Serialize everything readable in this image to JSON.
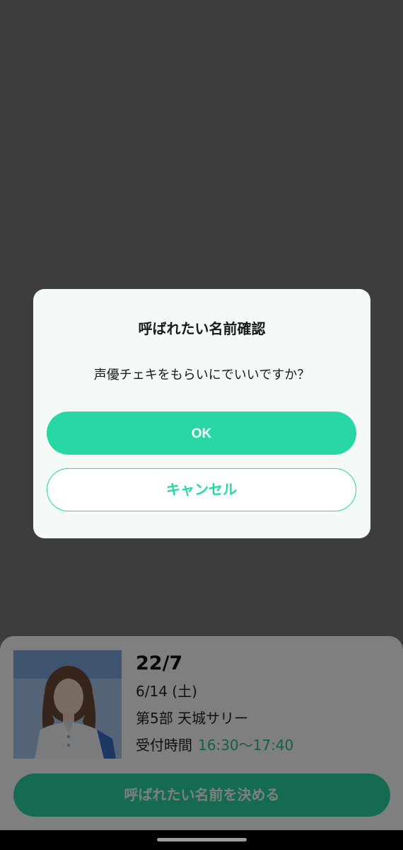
{
  "dialog": {
    "title": "呼ばれたい名前確認",
    "message": "声優チェキをもらいにでいいですか？",
    "ok_label": "OK",
    "cancel_label": "キャンセル"
  },
  "event": {
    "group_name": "22/7",
    "date": "6/14 (土)",
    "member": "第5部  天城サリー",
    "reception_label": "受付時間",
    "reception_time": "16:30〜17:40"
  },
  "decide_button_label": "呼ばれたい名前を決める",
  "colors": {
    "accent": "#28d7a4",
    "overlay": "rgba(0,0,0,0.5)",
    "dialog_bg": "#f4faf6"
  }
}
